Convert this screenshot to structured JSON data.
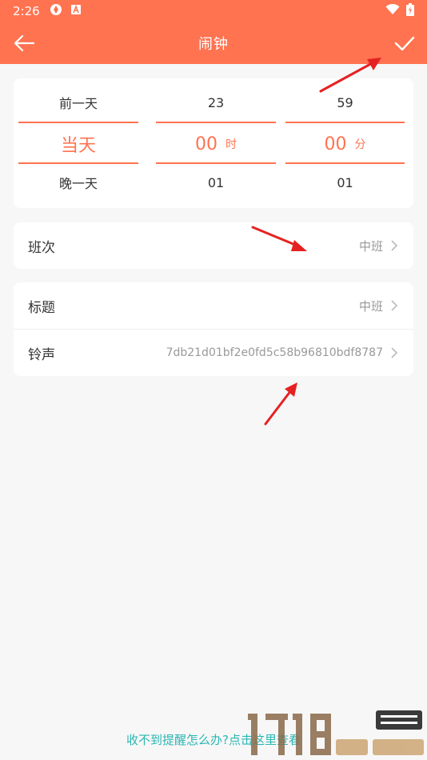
{
  "status_bar": {
    "time": "2:26"
  },
  "app_bar": {
    "title": "闹钟"
  },
  "picker": {
    "day": {
      "prev": "前一天",
      "current": "当天",
      "next": "晚一天"
    },
    "hour": {
      "prev": "23",
      "current": "00",
      "next": "01",
      "unit": "时"
    },
    "minute": {
      "prev": "59",
      "current": "00",
      "next": "01",
      "unit": "分"
    }
  },
  "shift_row": {
    "label": "班次",
    "value": "中班"
  },
  "title_row": {
    "label": "标题",
    "value": "中班"
  },
  "ringtone_row": {
    "label": "铃声",
    "value": "7db21d01bf2e0fd5c58b96810bdf8787"
  },
  "help_link": {
    "text": "收不到提醒怎么办?点击这里查看"
  },
  "colors": {
    "accent": "#ff7350",
    "link": "#2ab7b3",
    "annotation_arrow": "#e52222"
  }
}
